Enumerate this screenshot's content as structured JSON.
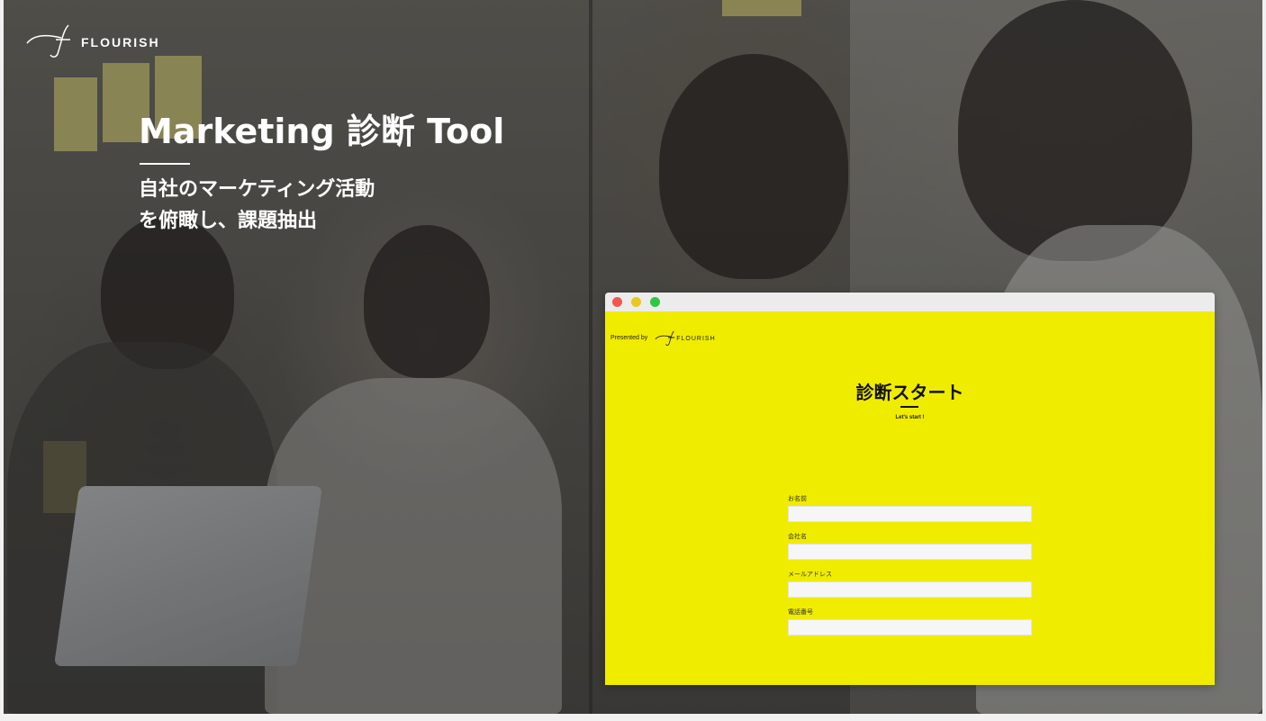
{
  "brand": {
    "name": "FLOURISH"
  },
  "hero": {
    "title": "Marketing 診断 Tool",
    "subtitle_line1": "自社のマーケティング活動",
    "subtitle_line2": "を俯瞰し、課題抽出"
  },
  "window": {
    "presented_by": "Presented by",
    "brand": "FLOURISH",
    "title": "診断スタート",
    "subtitle": "Let's start !",
    "fields": [
      {
        "label": "お名前",
        "value": ""
      },
      {
        "label": "会社名",
        "value": ""
      },
      {
        "label": "メールアドレス",
        "value": ""
      },
      {
        "label": "電話番号",
        "value": ""
      }
    ]
  },
  "colors": {
    "accent": "#f0ec00",
    "text": "#ffffff"
  },
  "icons": [
    "flourish-logo-icon",
    "window-close-icon",
    "window-minimize-icon",
    "window-maximize-icon"
  ]
}
